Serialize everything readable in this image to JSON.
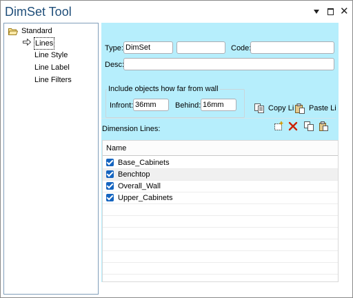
{
  "window": {
    "title": "DimSet Tool"
  },
  "tree": {
    "root": "Standard",
    "items": [
      {
        "label": "Lines",
        "selected": true
      },
      {
        "label": "Line Style"
      },
      {
        "label": "Line Label"
      },
      {
        "label": "Line Filters"
      }
    ]
  },
  "form": {
    "type_label": "Type:",
    "type_value": "DimSet",
    "second_value": "",
    "code_label": "Code:",
    "code_value": "",
    "desc_label": "Desc:",
    "desc_value": "",
    "group_title": "Include objects how far from wall",
    "infront_label": "Infront:",
    "infront_value": "36mm",
    "behind_label": "Behind:",
    "behind_value": "16mm",
    "copy_label": "Copy Li",
    "paste_label": "Paste Li"
  },
  "dimension_lines": {
    "heading": "Dimension Lines:",
    "column_header": "Name",
    "rows": [
      {
        "name": "Base_Cabinets",
        "checked": true
      },
      {
        "name": "Benchtop",
        "checked": true
      },
      {
        "name": "Overall_Wall",
        "checked": true
      },
      {
        "name": "Upper_Cabinets",
        "checked": true
      }
    ]
  },
  "colors": {
    "panel_bg": "#b6eefc",
    "title": "#1f4e79",
    "checkbox": "#1565c0",
    "delete": "#cc2200"
  }
}
